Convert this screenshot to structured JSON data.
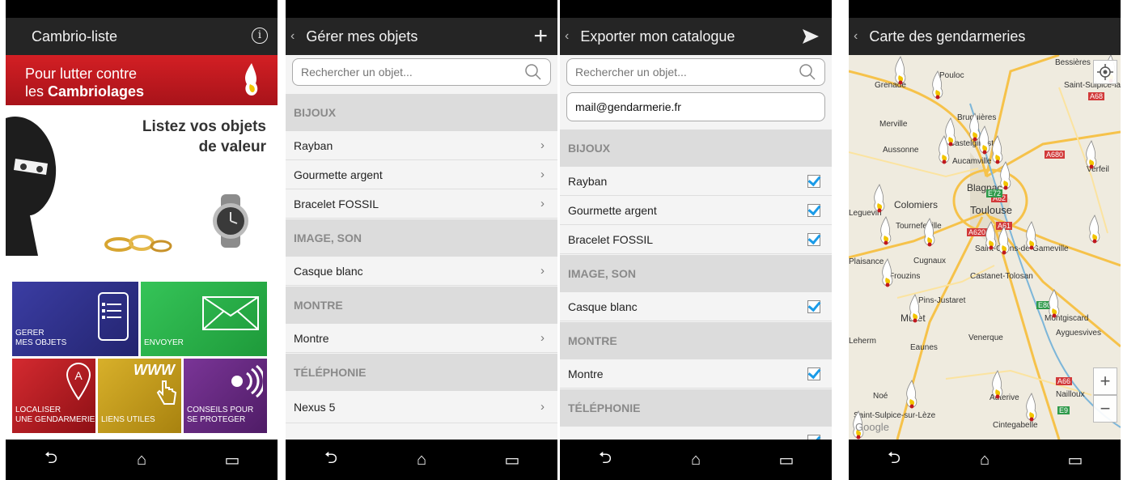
{
  "screen1": {
    "title": "Cambrio-liste",
    "banner_line1": "Pour lutter contre",
    "banner_line2_prefix": "les ",
    "banner_line2_bold": "Cambriolages",
    "tagline_line1": "Listez vos objets",
    "tagline_line2": "de valeur",
    "tiles": {
      "manage_line1": "GERER",
      "manage_line2": "MES OBJETS",
      "send": "ENVOYER",
      "locate_line1": "LOCALISER",
      "locate_line2": "UNE GENDARMERIE",
      "links": "LIENS UTILES",
      "advice_line1": "CONSEILS POUR",
      "advice_line2": "SE PROTEGER",
      "www_text": "WWW"
    },
    "colors": {
      "banner": "#c0181e",
      "tile_blue": "#2e2f8c",
      "tile_green": "#27b34a",
      "tile_red": "#c01a22",
      "tile_yellow": "#c9a21a",
      "tile_purple": "#6a2a86"
    }
  },
  "screen2": {
    "title": "Gérer mes objets",
    "search_placeholder": "Rechercher un objet...",
    "sections": [
      {
        "label": "BIJOUX",
        "items": [
          "Rayban",
          "Gourmette argent",
          "Bracelet FOSSIL"
        ]
      },
      {
        "label": "IMAGE, SON",
        "items": [
          "Casque blanc"
        ]
      },
      {
        "label": "MONTRE",
        "items": [
          "Montre"
        ]
      },
      {
        "label": "TÉLÉPHONIE",
        "items": [
          "Nexus 5"
        ]
      }
    ]
  },
  "screen3": {
    "title": "Exporter mon catalogue",
    "search_placeholder": "Rechercher un objet...",
    "email_value": "mail@gendarmerie.fr",
    "sections": [
      {
        "label": "BIJOUX",
        "items": [
          "Rayban",
          "Gourmette argent",
          "Bracelet FOSSIL"
        ]
      },
      {
        "label": "IMAGE, SON",
        "items": [
          "Casque blanc"
        ]
      },
      {
        "label": "MONTRE",
        "items": [
          "Montre"
        ]
      },
      {
        "label": "TÉLÉPHONIE",
        "items": []
      }
    ],
    "check_color": "#1a9be8"
  },
  "screen4": {
    "title": "Carte des gendarmeries",
    "zoom_in": "+",
    "zoom_out": "−",
    "watermark": "Google",
    "places": [
      "Bessières",
      "Grenade",
      "Pouloc",
      "Saint-Sulpice-la-P",
      "Merville",
      "Bruguières",
      "Castelginest",
      "Aussonne",
      "Aucamville",
      "Verfeil",
      "Blagnac",
      "Colomiers",
      "Toulouse",
      "Leguevin",
      "Tournefeuille",
      "Saint-Orens-de-Gameville",
      "Plaisance",
      "Cugnaux",
      "Frouzins",
      "Castanet-Tolosan",
      "Pins-Justaret",
      "Muret",
      "Montgiscard",
      "Ayguesvives",
      "Venerque",
      "Eaunes",
      "Noé",
      "Auterive",
      "Nailloux",
      "Saint-Sulpice-sur-Lèze",
      "Cintegabelle",
      "Leherm"
    ],
    "roads": [
      "A68",
      "A680",
      "A62",
      "E72",
      "A620",
      "A61",
      "E80",
      "A66",
      "E9"
    ]
  }
}
